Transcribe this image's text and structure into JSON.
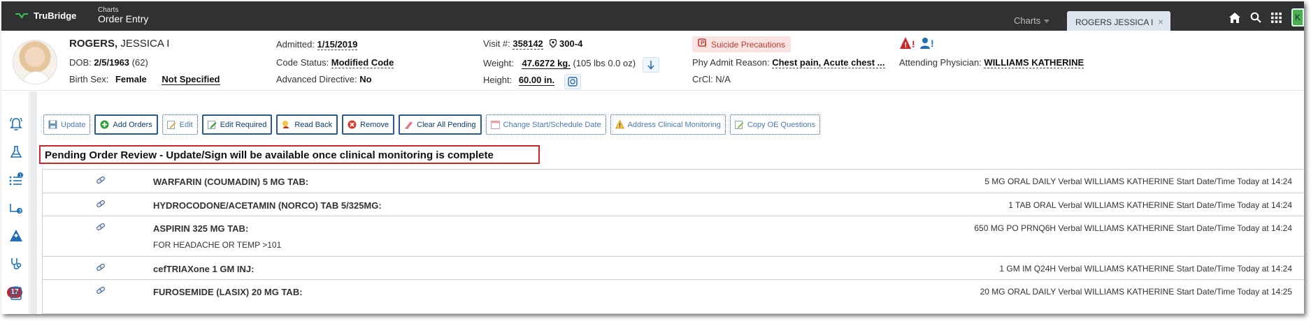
{
  "app": {
    "brand": "TruBridge",
    "module_sub": "Charts",
    "module_title": "Order Entry"
  },
  "tabs": {
    "charts_label": "Charts",
    "patient_label": "ROGERS JESSICA I"
  },
  "user": {
    "initial": "K"
  },
  "patient": {
    "last_name": "ROGERS,",
    "first_name": "JESSICA I",
    "dob_label": "DOB:",
    "dob": "2/5/1963",
    "age": "(62)",
    "birth_sex_label": "Birth Sex:",
    "birth_sex": "Female",
    "gender_identity": "Not Specified",
    "admitted_label": "Admitted:",
    "admitted": "1/15/2019",
    "code_status_label": "Code Status:",
    "code_status": "Modified Code",
    "adv_directive_label": "Advanced Directive:",
    "adv_directive": "No",
    "visit_label": "Visit #:",
    "visit": "358142",
    "room": "300-4",
    "weight_label": "Weight:",
    "weight": "47.6272 kg.",
    "weight_lbs": "(105 lbs 0.0 oz)",
    "height_label": "Height:",
    "height": "60.00 in.",
    "precaution": "Suicide Precautions",
    "phy_admit_label": "Phy Admit Reason:",
    "phy_admit": "Chest pain, Acute chest ...",
    "crcl_label": "CrCl:",
    "crcl": "N/A",
    "attending_label": "Attending Physician:",
    "attending": "WILLIAMS KATHERINE"
  },
  "rail": {
    "count_badge": "17",
    "list_badge": "1"
  },
  "toolbar": {
    "update": "Update",
    "add_orders": "Add Orders",
    "edit": "Edit",
    "edit_required": "Edit Required",
    "read_back": "Read Back",
    "remove": "Remove",
    "clear_all_pending": "Clear All Pending",
    "change_start": "Change Start/Schedule Date",
    "address_clinical": "Address Clinical Monitoring",
    "copy_oe": "Copy OE Questions"
  },
  "banner": "Pending Order Review - Update/Sign will be available once clinical monitoring is complete",
  "orders": [
    {
      "name": "WARFARIN (COUMADIN) 5 MG TAB:",
      "comment": "",
      "detail": "5 MG ORAL DAILY Verbal WILLIAMS KATHERINE Start Date/Time Today at 14:24"
    },
    {
      "name": "HYDROCODONE/ACETAMIN (NORCO) TAB 5/325MG:",
      "comment": "",
      "detail": "1 TAB ORAL Verbal WILLIAMS KATHERINE Start Date/Time Today at 14:24"
    },
    {
      "name": "ASPIRIN 325 MG TAB:",
      "comment": "FOR HEADACHE OR TEMP >101",
      "detail": "650 MG PO PRNQ6H Verbal WILLIAMS KATHERINE Start Date/Time Today at 14:24"
    },
    {
      "name": "cefTRIAXone 1 GM INJ:",
      "comment": "",
      "detail": "1 GM IM Q24H Verbal WILLIAMS KATHERINE Start Date/Time Today at 14:24"
    },
    {
      "name": "FUROSEMIDE (LASIX) 20 MG TAB:",
      "comment": "",
      "detail": "20 MG ORAL DAILY Verbal WILLIAMS KATHERINE Start Date/Time Today at 14:25"
    }
  ],
  "colors": {
    "topbar": "#2f3133",
    "accent": "#2b5a8a",
    "alert_red": "#c62828",
    "badge_red": "#b9292f"
  }
}
